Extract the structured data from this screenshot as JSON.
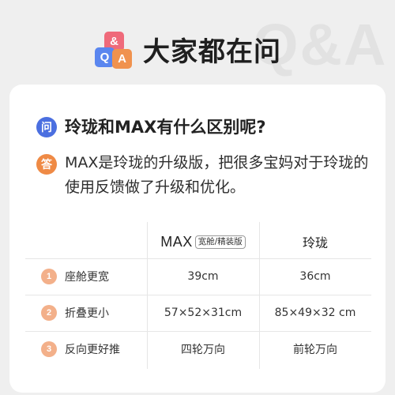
{
  "header": {
    "logo": {
      "amp": "&",
      "q": "Q",
      "a": "A"
    },
    "title": "大家都在问",
    "watermark": "Q&A"
  },
  "question": {
    "badge": "问",
    "text": "玲珑和MAX有什么区别呢?"
  },
  "answer": {
    "badge": "答",
    "text": "MAX是玲珑的升级版，把很多宝妈对于玲珑的使用反馈做了升级和优化。"
  },
  "table": {
    "columns": {
      "max": "MAX",
      "max_tag": "宽舱/精装版",
      "linglong": "玲珑"
    },
    "rows": [
      {
        "num": "1",
        "label": "座舱更宽",
        "max": "39cm",
        "linglong": "36cm"
      },
      {
        "num": "2",
        "label": "折叠更小",
        "max": "57×52×31cm",
        "linglong": "85×49×32 cm"
      },
      {
        "num": "3",
        "label": "反向更好推",
        "max": "四轮万向",
        "linglong": "前轮万向"
      }
    ]
  },
  "colors": {
    "background": "#efefef",
    "card": "#ffffff",
    "question_badge": "#4b6fe0",
    "answer_badge": "#ef8a45",
    "row_number": "#f3b08a",
    "logo_tiles": [
      "#ef6a7a",
      "#5a86ef",
      "#f0924e"
    ]
  }
}
